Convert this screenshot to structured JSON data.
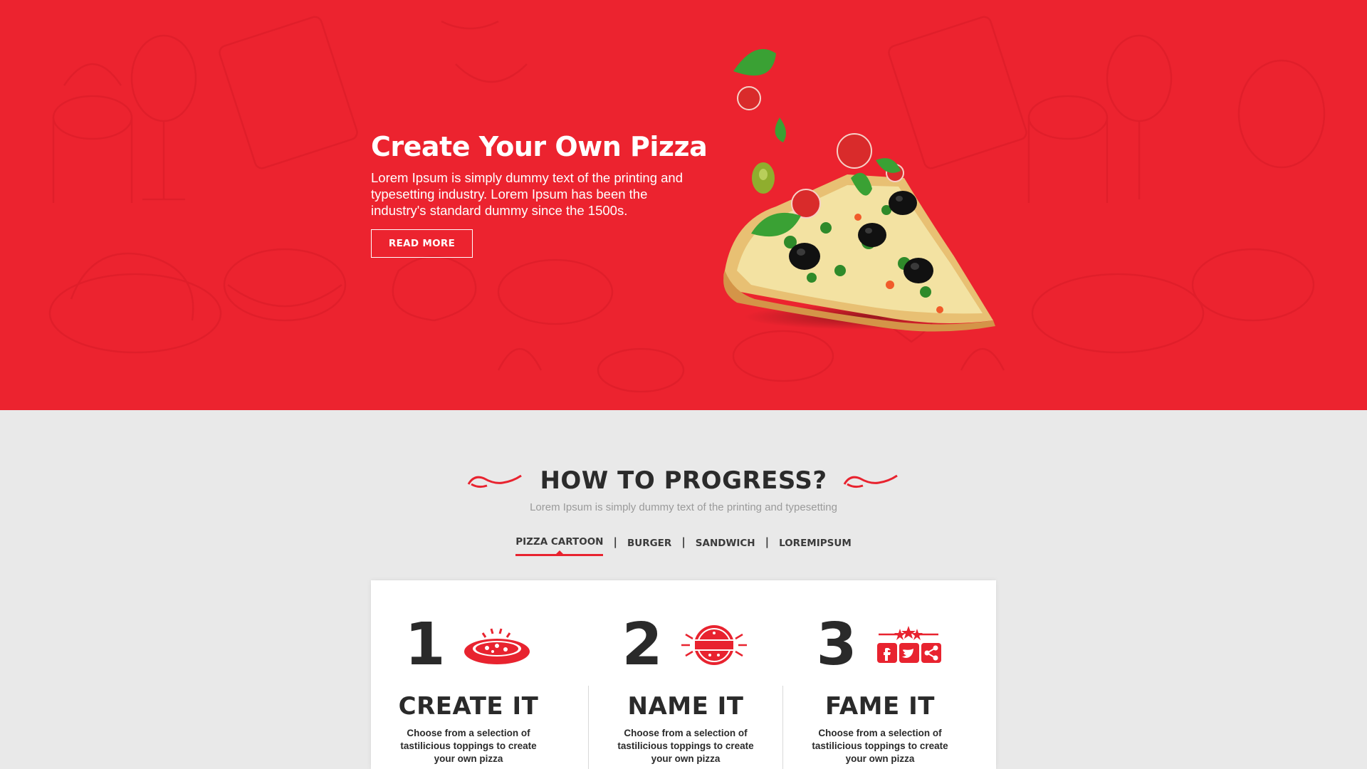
{
  "colors": {
    "brand_red": "#ec232f",
    "dark_text": "#2b2b2b",
    "muted_text": "#9a9a9a",
    "section_bg": "#e9e9e9"
  },
  "hero": {
    "title": "Create Your Own Pizza",
    "description": "Lorem Ipsum is simply dummy text of the printing and typesetting industry. Lorem Ipsum has been the industry's standard dummy since the 1500s.",
    "read_more_label": "READ MORE",
    "image": "pizza-slice-with-flying-toppings"
  },
  "progress": {
    "title": "HOW TO PROGRESS?",
    "subtitle": "Lorem Ipsum is simply dummy text of the printing and typesetting",
    "tabs": [
      {
        "label": "PIZZA CARTOON",
        "active": true
      },
      {
        "label": "BURGER",
        "active": false
      },
      {
        "label": "SANDWICH",
        "active": false
      },
      {
        "label": "LOREMIPSUM",
        "active": false
      }
    ],
    "steps": [
      {
        "number": "1",
        "title": "CREATE IT",
        "description": "Choose from a selection of tastilicious toppings to create your own pizza",
        "icon": "pizza-icon"
      },
      {
        "number": "2",
        "title": "NAME IT",
        "description": "Choose from a selection of tastilicious toppings to create your own pizza",
        "icon": "badge-ribbon-icon"
      },
      {
        "number": "3",
        "title": "FAME IT",
        "description": "Choose from a selection of tastilicious toppings to create your own pizza",
        "icon": "social-share-icon"
      }
    ]
  }
}
